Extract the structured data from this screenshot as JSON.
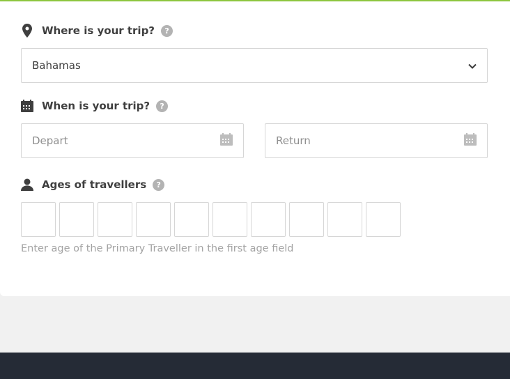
{
  "destination": {
    "label": "Where is your trip?",
    "help": "?",
    "selected": "Bahamas"
  },
  "dates": {
    "label": "When is your trip?",
    "help": "?",
    "depart_placeholder": "Depart",
    "return_placeholder": "Return"
  },
  "travellers": {
    "label": "Ages of travellers",
    "help": "?",
    "age_fields": [
      "",
      "",
      "",
      "",
      "",
      "",
      "",
      "",
      "",
      ""
    ],
    "hint": "Enter age of the Primary Traveller in the first age field"
  },
  "colors": {
    "accent_line": "#8dc63f",
    "footer": "#252b36"
  },
  "icons": [
    "location-pin-icon",
    "calendar-icon",
    "person-icon",
    "help-icon",
    "chevron-down-icon"
  ]
}
